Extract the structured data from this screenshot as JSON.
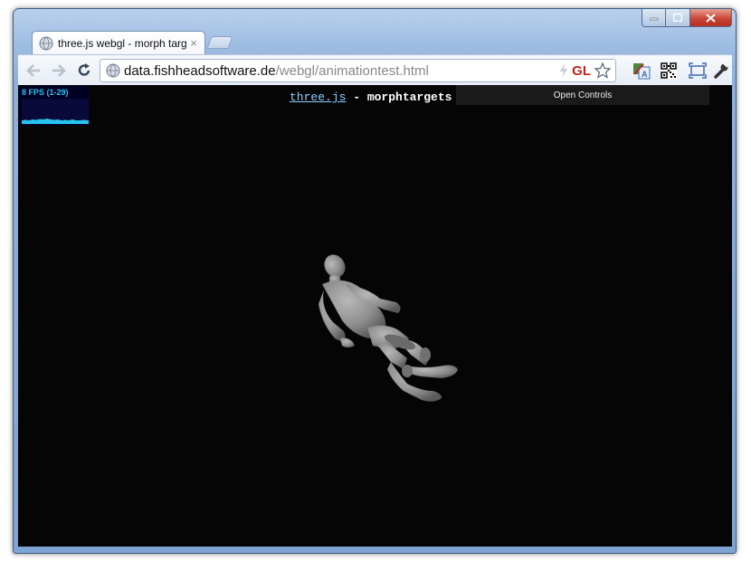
{
  "window": {
    "tab_title": "three.js webgl - morph targ",
    "tab_close": "×",
    "url_host": "data.fishheadsoftware.de",
    "url_path": "/webgl/animationtest.html",
    "gl_badge": "GL"
  },
  "page": {
    "fps_label": "8 FPS (1-29)",
    "info_link": "three.js",
    "info_rest": " - morphtargets",
    "controls_button": "Open Controls",
    "background_color": "#050505",
    "stats_color": "#27c3ef"
  },
  "icons": [
    "globe-icon",
    "back-arrow-icon",
    "forward-arrow-icon",
    "reload-icon",
    "lightning-icon",
    "star-icon",
    "translate-icon",
    "qr-code-icon",
    "fullscreen-icon",
    "wrench-icon"
  ]
}
